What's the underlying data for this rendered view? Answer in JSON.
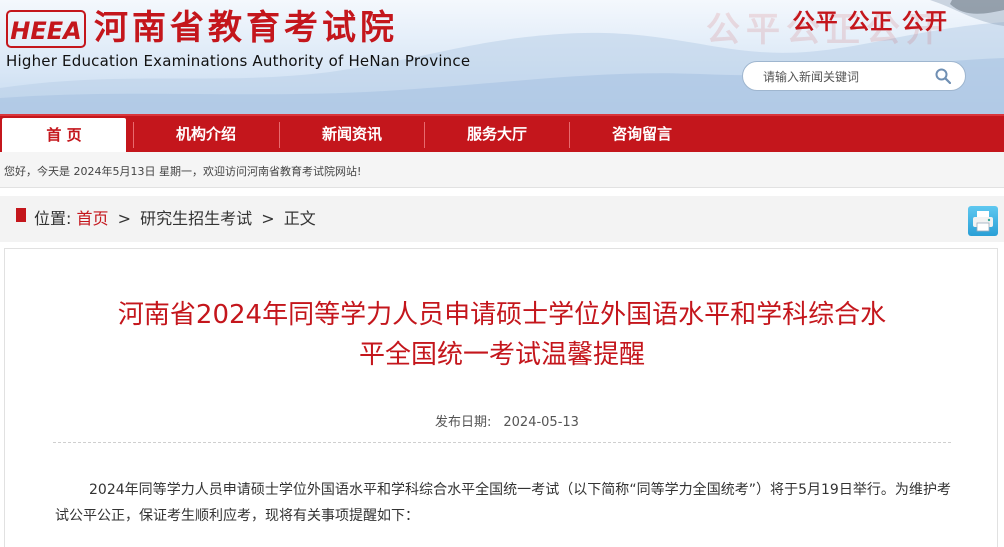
{
  "header": {
    "logo_text": "HEEA",
    "title": "河南省教育考试院",
    "subtitle": "Higher Education Examinations Authority of HeNan Province",
    "slogan": "公平 公正 公开",
    "slogan_shadow": "公平公正公开",
    "search_placeholder": "请输入新闻关键词"
  },
  "nav": {
    "items": [
      {
        "label": "首 页"
      },
      {
        "label": "机构介绍"
      },
      {
        "label": "新闻资讯"
      },
      {
        "label": "服务大厅"
      },
      {
        "label": "咨询留言"
      }
    ]
  },
  "welcome": "您好，今天是 2024年5月13日 星期一，欢迎访问河南省教育考试院网站!",
  "breadcrumb": {
    "label": "位置:",
    "home": "首页",
    "sep": ">",
    "section": "研究生招生考试",
    "current": "正文"
  },
  "article": {
    "title": "河南省2024年同等学力人员申请硕士学位外国语水平和学科综合水\n平全国统一考试温馨提醒",
    "pubdate_label": "发布日期:",
    "pubdate_value": "2024-05-13",
    "paragraph": "2024年同等学力人员申请硕士学位外国语水平和学科综合水平全国统一考试（以下简称“同等学力全国统考”）将于5月19日举行。为维护考试公平公正，保证考生顺利应考，现将有关事项提醒如下："
  },
  "colors": {
    "brand_red": "#c4161c",
    "print_blue": "#2a9fd6"
  },
  "icons": [
    "heea-logo",
    "search-icon",
    "print-icon"
  ]
}
